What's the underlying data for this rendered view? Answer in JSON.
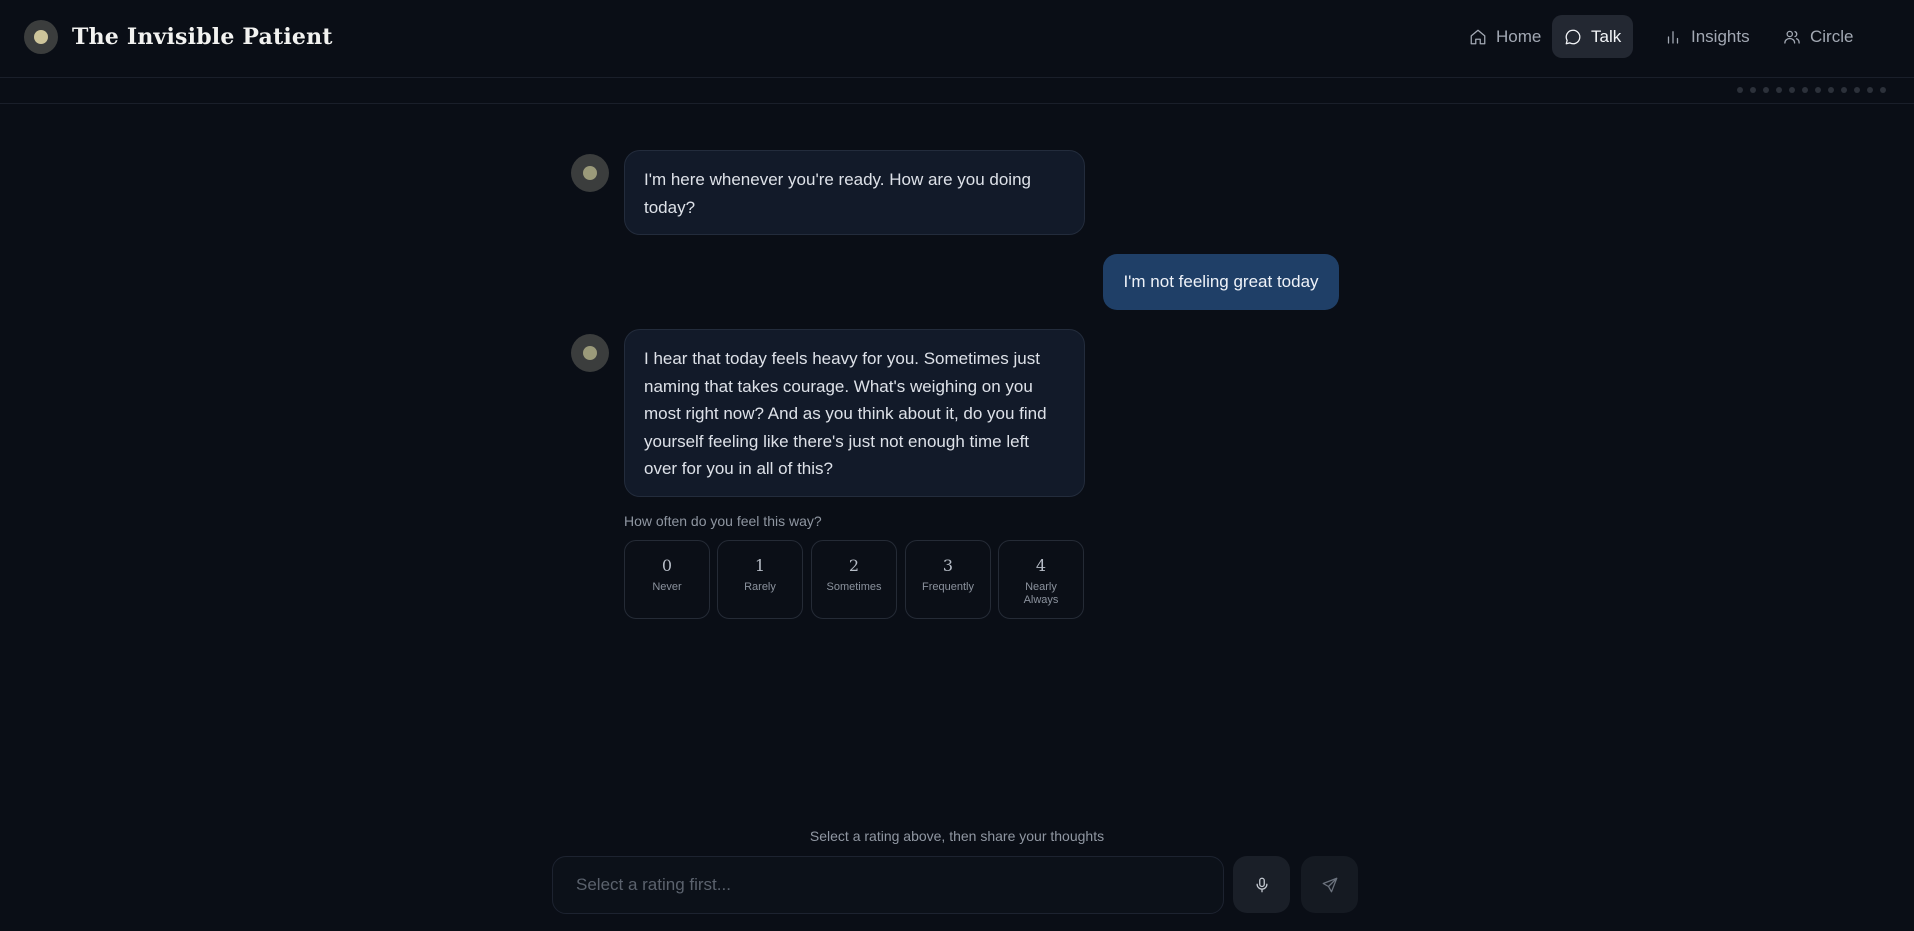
{
  "app": {
    "title": "The Invisible Patient"
  },
  "nav": [
    {
      "label": "Home",
      "icon": "home-icon",
      "active": false
    },
    {
      "label": "Talk",
      "icon": "chat-icon",
      "active": true
    },
    {
      "label": "Insights",
      "icon": "bar-chart-icon",
      "active": false
    },
    {
      "label": "Circle",
      "icon": "users-icon",
      "active": false
    }
  ],
  "progress": {
    "total_steps": 12
  },
  "messages": [
    {
      "role": "assistant",
      "text": "I'm here whenever you're ready. How are you doing today?"
    },
    {
      "role": "user",
      "text": "I'm not feeling great today"
    },
    {
      "role": "assistant",
      "text": "I hear that today feels heavy for you. Sometimes just naming that takes courage. What's weighing on you most right now? And as you think about it, do you find yourself feeling like there's just not enough time left over for you in all of this?"
    }
  ],
  "rating": {
    "prompt": "How often do you feel this way?",
    "options": [
      {
        "value": "0",
        "label": "Never"
      },
      {
        "value": "1",
        "label": "Rarely"
      },
      {
        "value": "2",
        "label": "Sometimes"
      },
      {
        "value": "3",
        "label": "Frequently"
      },
      {
        "value": "4",
        "label": "Nearly Always"
      }
    ]
  },
  "composer": {
    "hint": "Select a rating above, then share your thoughts",
    "placeholder": "Select a rating first...",
    "mic_icon": "microphone-icon",
    "send_icon": "send-icon"
  },
  "colors": {
    "background": "#0a0e16",
    "accent": "#1f3f67",
    "assistant_bubble": "#121a29",
    "logo_dot": "#cdc49a"
  }
}
